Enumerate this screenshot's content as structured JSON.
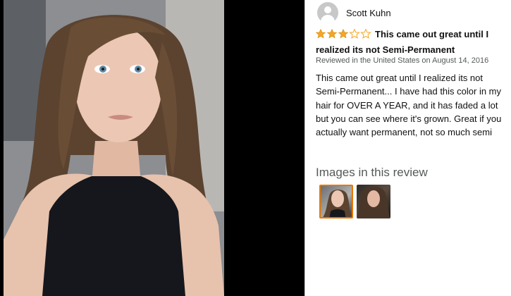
{
  "reviewer": {
    "name": "Scott Kuhn",
    "avatar_icon": "default-avatar-icon"
  },
  "review": {
    "rating": 3,
    "rating_max": 5,
    "star_fill_color": "#f5a623",
    "star_empty_color": "#f5a623",
    "title": "This came out great until I realized its not Semi-Permanent",
    "date": "Reviewed in the United States on August 14, 2016",
    "body": "This came out great until I realized its not Semi-Permanent... I have had this color in my hair for OVER A YEAR, and it has faded a lot but you can see where it's grown. Great if you actually want permanent, not so much semi"
  },
  "images_section": {
    "heading": "Images in this review",
    "selected_index": 0,
    "selected_border_color": "#e77600"
  },
  "colors": {
    "media_background": "#000000",
    "heading_gray": "#565959"
  }
}
